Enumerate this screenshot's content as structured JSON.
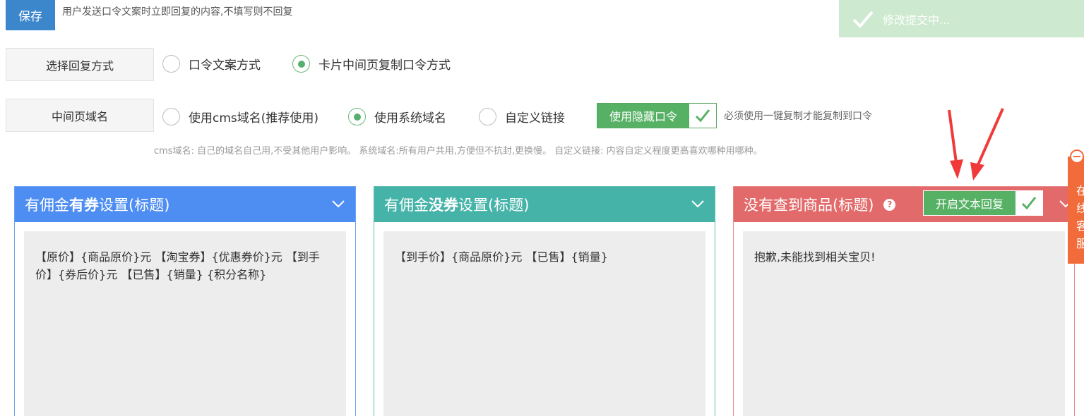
{
  "toolbar": {
    "save_label": "保存",
    "save_hint": "用户发送口令文案时立即回复的内容,不填写则不回复"
  },
  "toast": {
    "message": "修改提交中..."
  },
  "reply_mode": {
    "label": "选择回复方式",
    "options": [
      {
        "label": "口令文案方式",
        "checked": false
      },
      {
        "label": "卡片中间页复制口令方式",
        "checked": true
      }
    ]
  },
  "domain": {
    "label": "中间页域名",
    "options": [
      {
        "label": "使用cms域名(推荐使用)",
        "checked": false
      },
      {
        "label": "使用系统域名",
        "checked": true
      },
      {
        "label": "自定义链接",
        "checked": false
      }
    ],
    "hidden_token_toggle": {
      "label": "使用隐藏口令",
      "on": true
    },
    "toggle_hint": "必须使用一键复制才能复制到口令",
    "description": "cms域名: 自己的域名自己用,不受其他用户影响。   系统域名:所有用户共用,方便但不抗封,更换慢。   自定义链接: 内容自定义程度更高喜欢哪种用哪种。"
  },
  "panels": [
    {
      "title_prefix": "有佣金",
      "title_bold": "有券",
      "title_suffix": "设置(标题)",
      "color": "#4e8ef2",
      "content": "【原价】{商品原价}元 【淘宝券】{优惠券价}元 【到手价】{券后价}元 【已售】{销量} {积分名称}"
    },
    {
      "title_prefix": "有佣金",
      "title_bold": "没券",
      "title_suffix": "设置(标题)",
      "color": "#46b3a9",
      "content": "【到手价】{商品原价}元 【已售】{销量}"
    },
    {
      "title_prefix": "没有查到商品(标题)",
      "title_bold": "",
      "title_suffix": "",
      "color": "#e36a6a",
      "help_icon": "?",
      "text_reply_toggle": {
        "label": "开启文本回复",
        "on": true
      },
      "content": "抱歉,未能找到相关宝贝!"
    }
  ],
  "side_tab": {
    "text": "在\n线\n客\n服"
  },
  "colors": {
    "accent_blue": "#3c86cc",
    "green": "#57b165",
    "orange": "#f26c3b",
    "arrow_red": "#f03a3a"
  },
  "icons": [
    "check-icon",
    "chevron-down-icon",
    "help-icon",
    "arrow-icon"
  ]
}
